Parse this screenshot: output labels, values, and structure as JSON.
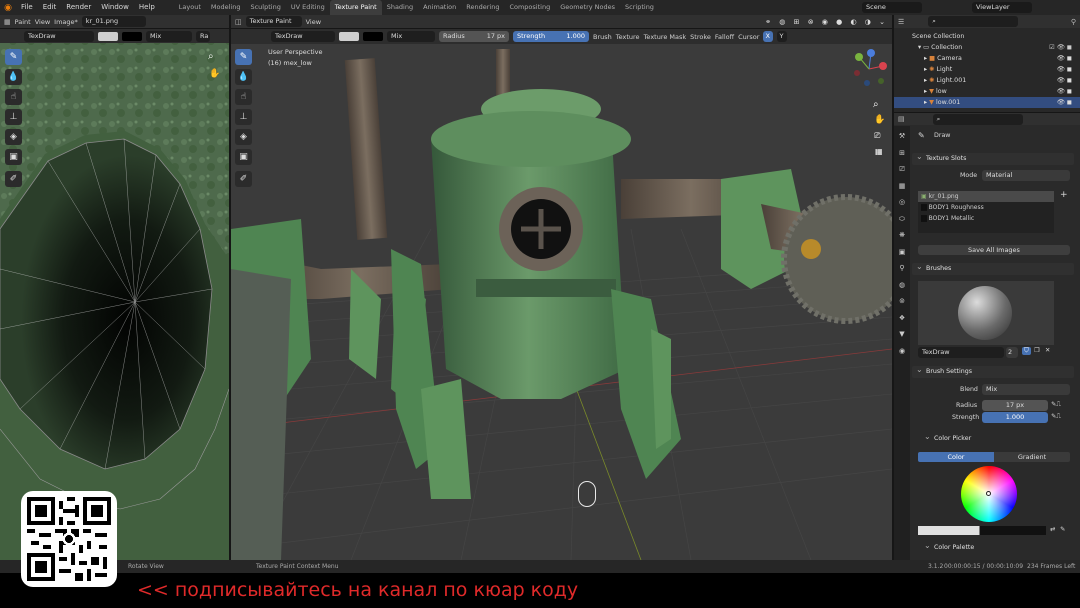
{
  "menu": [
    "File",
    "Edit",
    "Render",
    "Window",
    "Help"
  ],
  "workspaces": [
    "Layout",
    "Modeling",
    "Sculpting",
    "UV Editing",
    "Texture Paint",
    "Shading",
    "Animation",
    "Rendering",
    "Compositing",
    "Geometry Nodes",
    "Scripting"
  ],
  "active_workspace": "Texture Paint",
  "scene": "Scene",
  "view_layer": "ViewLayer",
  "uv_header": {
    "mode": "Paint",
    "view": "View",
    "image_menu": "Image*",
    "image_name": "kr_01.png"
  },
  "uv_tool": {
    "brush": "TexDraw",
    "blend": "Mix",
    "extra": "Ra"
  },
  "vp_header": {
    "mode": "Texture Paint",
    "view": "View"
  },
  "vp_tool": {
    "brush": "TexDraw",
    "blend": "Mix",
    "radius_label": "Radius",
    "radius_value": "17 px",
    "strength_label": "Strength",
    "strength_value": "1.000",
    "menus": [
      "Brush",
      "Texture",
      "Texture Mask",
      "Stroke",
      "Falloff",
      "Cursor"
    ],
    "axes": [
      "X",
      "Y"
    ]
  },
  "vp_overlay": {
    "line1": "User Perspective",
    "line2": "(16) mex_low"
  },
  "outliner": {
    "items": [
      "Scene Collection",
      "Collection",
      "Camera",
      "Light",
      "Light.001",
      "low",
      "low.001"
    ]
  },
  "props": {
    "tool_name": "Draw",
    "texture_slots": "Texture Slots",
    "mode_label": "Mode",
    "mode_value": "Material",
    "slots": [
      "kr_01.png",
      "BODY1 Roughness",
      "BODY1 Metallic"
    ],
    "save_all": "Save All Images",
    "brushes": "Brushes",
    "brush_name": "TexDraw",
    "brush_users": "2",
    "brush_settings": "Brush Settings",
    "blend_label": "Blend",
    "blend_value": "Mix",
    "radius_label": "Radius",
    "radius_value": "17 px",
    "strength_label": "Strength",
    "strength_value": "1.000",
    "color_picker": "Color Picker",
    "tab_color": "Color",
    "tab_gradient": "Gradient",
    "color_palette": "Color Palette"
  },
  "status": {
    "left": "Rotate View",
    "mid": "Texture Paint Context Menu",
    "version": "3.1.2",
    "time": "00:00:00:15 / 00:00:10:09",
    "frames": "234 Frames Left"
  },
  "caption": "<< подписывайтесь на канал по кюар коду"
}
